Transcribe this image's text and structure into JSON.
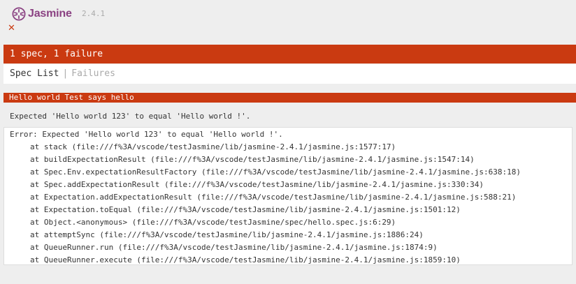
{
  "banner": {
    "logo_text": "Jasmine",
    "version": "2.4.1"
  },
  "symbol_summary": {
    "failed_symbol": "✕"
  },
  "alert": {
    "summary": "1 spec, 1 failure"
  },
  "menu": {
    "spec_list": "Spec List",
    "separator": "|",
    "failures": "Failures"
  },
  "failure": {
    "description": "Hello world Test says hello",
    "message": "Expected 'Hello world 123' to equal 'Hello world !'.",
    "stack": [
      "Error: Expected 'Hello world 123' to equal 'Hello world !'.",
      "at stack (file:///f%3A/vscode/testJasmine/lib/jasmine-2.4.1/jasmine.js:1577:17)",
      "at buildExpectationResult (file:///f%3A/vscode/testJasmine/lib/jasmine-2.4.1/jasmine.js:1547:14)",
      "at Spec.Env.expectationResultFactory (file:///f%3A/vscode/testJasmine/lib/jasmine-2.4.1/jasmine.js:638:18)",
      "at Spec.addExpectationResult (file:///f%3A/vscode/testJasmine/lib/jasmine-2.4.1/jasmine.js:330:34)",
      "at Expectation.addExpectationResult (file:///f%3A/vscode/testJasmine/lib/jasmine-2.4.1/jasmine.js:588:21)",
      "at Expectation.toEqual (file:///f%3A/vscode/testJasmine/lib/jasmine-2.4.1/jasmine.js:1501:12)",
      "at Object.<anonymous> (file:///f%3A/vscode/testJasmine/spec/hello.spec.js:6:29)",
      "at attemptSync (file:///f%3A/vscode/testJasmine/lib/jasmine-2.4.1/jasmine.js:1886:24)",
      "at QueueRunner.run (file:///f%3A/vscode/testJasmine/lib/jasmine-2.4.1/jasmine.js:1874:9)",
      "at QueueRunner.execute (file:///f%3A/vscode/testJasmine/lib/jasmine-2.4.1/jasmine.js:1859:10)"
    ]
  },
  "colors": {
    "failure_red": "#ca3a11",
    "brand_purple": "#8a4182",
    "muted_gray": "#aaaaaa",
    "page_bg": "#eeeeee"
  }
}
